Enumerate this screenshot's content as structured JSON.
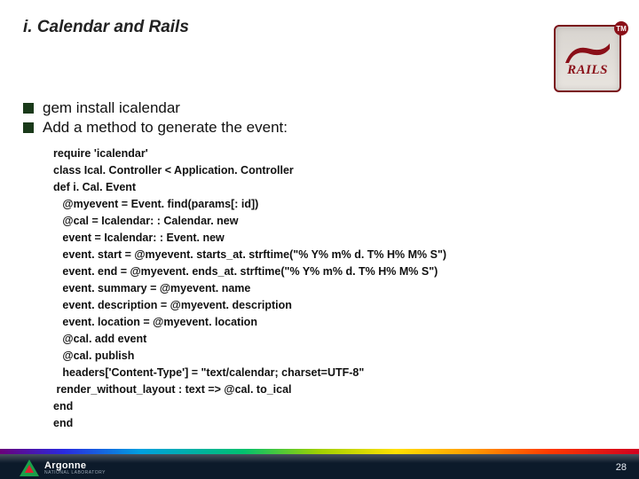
{
  "title": "i. Calendar and Rails",
  "rails_logo": {
    "text": "RAILS",
    "tm": "TM"
  },
  "bullets": [
    "gem install icalendar",
    "Add a method to generate the event:"
  ],
  "code_lines": [
    {
      "indent": 0,
      "text": "require 'icalendar'"
    },
    {
      "indent": 0,
      "text": "class Ical. Controller < Application. Controller"
    },
    {
      "indent": 0,
      "text": "def i. Cal. Event"
    },
    {
      "indent": 1,
      "text": "@myevent = Event. find(params[: id])"
    },
    {
      "indent": 1,
      "text": "@cal = Icalendar: : Calendar. new"
    },
    {
      "indent": 1,
      "text": "event = Icalendar: : Event. new"
    },
    {
      "indent": 1,
      "text": "event. start = @myevent. starts_at. strftime(\"% Y% m% d. T% H% M% S\")"
    },
    {
      "indent": 1,
      "text": "event. end = @myevent. ends_at. strftime(\"% Y% m% d. T% H% M% S\")"
    },
    {
      "indent": 1,
      "text": "event. summary = @myevent. name"
    },
    {
      "indent": 1,
      "text": "event. description = @myevent. description"
    },
    {
      "indent": 1,
      "text": "event. location = @myevent. location"
    },
    {
      "indent": 1,
      "text": "@cal. add event"
    },
    {
      "indent": 1,
      "text": "@cal. publish"
    },
    {
      "indent": 1,
      "text": "headers['Content-Type'] = \"text/calendar; charset=UTF-8\""
    },
    {
      "indent": 0.5,
      "text": "render_without_layout : text => @cal. to_ical"
    },
    {
      "indent": 0,
      "text": "end"
    },
    {
      "indent": 0,
      "text": "end"
    }
  ],
  "footer": {
    "org_name": "Argonne",
    "org_sub": "NATIONAL LABORATORY",
    "page": "28"
  }
}
